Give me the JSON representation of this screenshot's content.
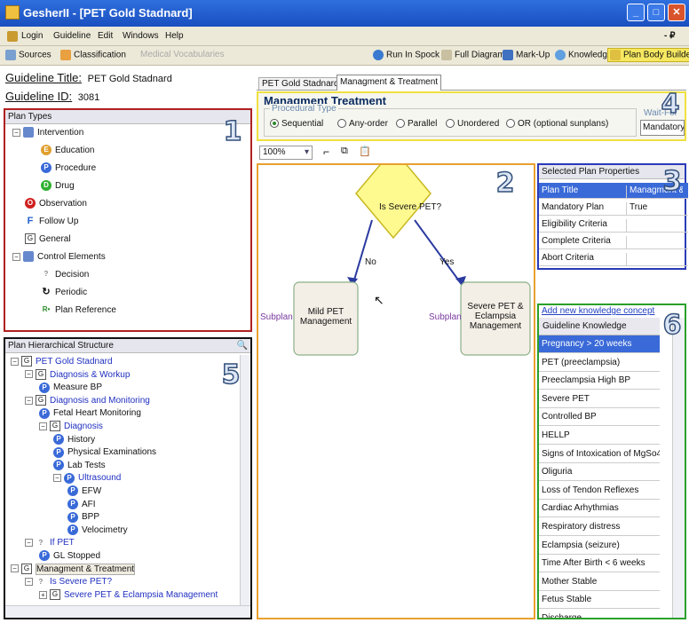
{
  "window": {
    "title": "GesherII - [PET Gold Stadnard]",
    "minimize": "_",
    "maximize": "□",
    "close": "✕"
  },
  "menu": {
    "items": [
      "Login",
      "Guideline",
      "Edit",
      "Windows",
      "Help"
    ],
    "restore": "- ₽"
  },
  "toolbar": {
    "sources": "Sources",
    "classification": "Classification",
    "vocab": "Medical Vocabularies",
    "run": "Run In Spock",
    "full": "Full Diagram",
    "markup": "Mark-Up",
    "knowledge": "Knowledge",
    "plan_body": "Plan Body Builder"
  },
  "guideline": {
    "title_label": "Guideline Title:",
    "title_value": "PET Gold Stadnard",
    "id_label": "Guideline ID:",
    "id_value": "3081"
  },
  "plan_types": {
    "header": "Plan Types",
    "items": [
      "Intervention",
      "Education",
      "Procedure",
      "Drug",
      "Observation",
      "Follow Up",
      "General",
      "Control Elements",
      "Decision",
      "Periodic",
      "Plan Reference"
    ]
  },
  "badges": [
    "1",
    "2",
    "3",
    "4",
    "5",
    "6"
  ],
  "hierarchy": {
    "header": "Plan Hierarchical Structure",
    "items": [
      "PET Gold Stadnard",
      "Diagnosis & Workup",
      "Measure BP",
      "Diagnosis and Monitoring",
      "Fetal Heart Monitoring",
      "Diagnosis",
      "History",
      "Physical Examinations",
      "Lab Tests",
      "Ultrasound",
      "EFW",
      "AFI",
      "BPP",
      "Velocimetry",
      "If PET",
      "GL Stopped",
      "Managment & Treatment",
      "Is Severe PET?",
      "Severe PET & Eclampsia Management"
    ]
  },
  "tabs": [
    "PET Gold Stadnard",
    "Managment & Treatment"
  ],
  "plan": {
    "title": "Managment  Treatment",
    "procedural_label": "Procedural Type",
    "procedural_options": [
      "Sequential",
      "Any-order",
      "Parallel",
      "Unordered",
      "OR (optional sunplans)"
    ],
    "waitfor_label": "Wait-For",
    "waitfor_value": "Mandatory plans only"
  },
  "zoom": "100%",
  "diagram": {
    "decision": "Is Severe PET?",
    "no": "No",
    "yes": "Yes",
    "left_node": "Mild PET Management",
    "right_node": "Severe PET & Eclampsia Management",
    "left_sub": "Subplan",
    "right_sub": "Subplan"
  },
  "properties": {
    "header": "Selected Plan Properties",
    "rows": [
      {
        "k": "Plan Title",
        "v": "Managment & Tre..."
      },
      {
        "k": "Mandatory Plan",
        "v": "True"
      },
      {
        "k": "Eligibility Criteria",
        "v": ""
      },
      {
        "k": "Complete Criteria",
        "v": ""
      },
      {
        "k": "Abort Criteria",
        "v": ""
      }
    ]
  },
  "knowledge": {
    "add_link": "Add new knowledge concept",
    "header": "Guideline Knowledge Concepts",
    "items": [
      "Pregnancy > 20 weeks",
      "PET (preeclampsia)",
      "Preeclampsia High BP",
      "Severe PET",
      "Controlled BP",
      "HELLP",
      "Signs of Intoxication of MgSo4",
      "Oliguria",
      "Loss of Tendon Reflexes",
      "Cardiac Arhythmias",
      "Respiratory distress",
      "Eclampsia (seizure)",
      "Time After Birth < 6 weeks",
      "Mother Stable",
      "Fetus Stable",
      "Discharge"
    ]
  }
}
